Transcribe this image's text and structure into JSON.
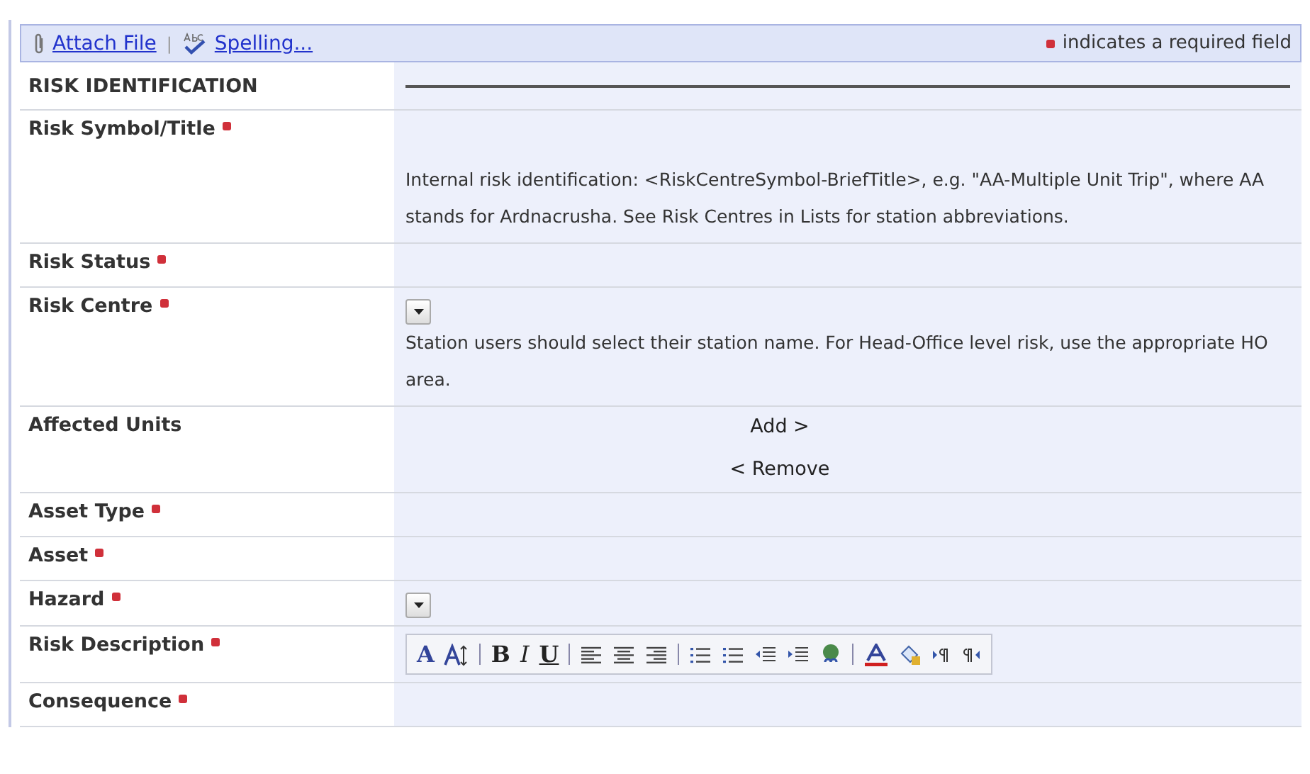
{
  "toolbar": {
    "links": [
      {
        "kind": "attach",
        "label": "Attach File"
      },
      {
        "kind": "spelling",
        "label": "Spelling..."
      }
    ],
    "separator": "|",
    "legend": "indicates a required field"
  },
  "rows": [
    {
      "kind": "section",
      "label": "RISK IDENTIFICATION"
    },
    {
      "kind": "field",
      "label": "Risk Symbol/Title",
      "required": true,
      "help": "Internal risk identification: <RiskCentreSymbol-BriefTitle>, e.g. \"AA-Multiple Unit Trip\", where AA stands for Ardnacrusha. See Risk Centres in Lists for station abbreviations."
    },
    {
      "kind": "field",
      "label": "Risk Status",
      "required": true
    },
    {
      "kind": "field",
      "label": "Risk Centre",
      "required": true,
      "dropdown": true,
      "help": "Station users should select their station name. For Head-Office level risk, use the appropriate HO area."
    },
    {
      "kind": "field",
      "label": "Affected Units",
      "required": false,
      "buttons": [
        "Add >",
        "< Remove"
      ]
    },
    {
      "kind": "field",
      "label": "Asset Type",
      "required": true
    },
    {
      "kind": "field",
      "label": "Asset",
      "required": true
    },
    {
      "kind": "field",
      "label": "Hazard",
      "required": true,
      "dropdown": true
    },
    {
      "kind": "field",
      "label": "Risk Description",
      "required": true,
      "editor": [
        {
          "kind": "glyph",
          "text": "A"
        },
        {
          "kind": "font-size"
        },
        {
          "kind": "sep"
        },
        {
          "kind": "bold",
          "text": "B"
        },
        {
          "kind": "italic",
          "text": "I"
        },
        {
          "kind": "underline",
          "text": "U"
        },
        {
          "kind": "sep"
        },
        {
          "kind": "align-left"
        },
        {
          "kind": "align-center"
        },
        {
          "kind": "align-right"
        },
        {
          "kind": "sep"
        },
        {
          "kind": "ordered-list"
        },
        {
          "kind": "bullet-list"
        },
        {
          "kind": "outdent"
        },
        {
          "kind": "indent"
        },
        {
          "kind": "link"
        },
        {
          "kind": "sep"
        },
        {
          "kind": "text-color"
        },
        {
          "kind": "highlight"
        },
        {
          "kind": "ltr"
        },
        {
          "kind": "rtl"
        }
      ]
    },
    {
      "kind": "field",
      "label": "Consequence",
      "required": true
    }
  ]
}
